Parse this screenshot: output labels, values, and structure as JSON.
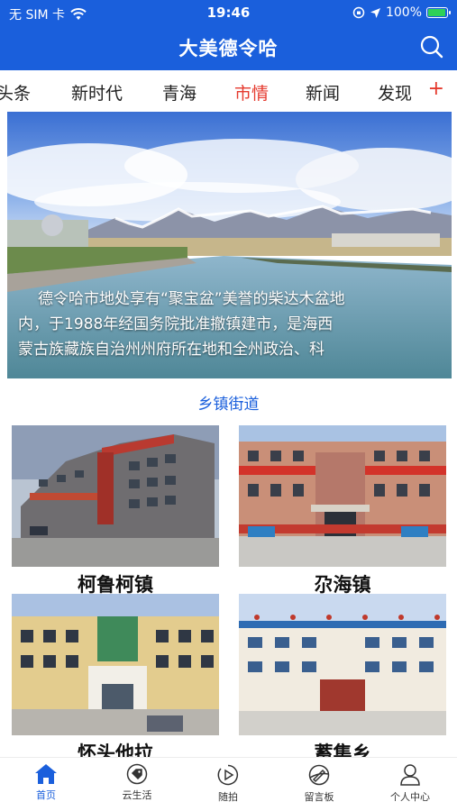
{
  "status_bar": {
    "carrier": "无 SIM 卡",
    "time": "19:46",
    "battery": "100%",
    "battery_level": 1.0
  },
  "header": {
    "title": "大美德令哈",
    "search_icon": "search-icon"
  },
  "tabs": [
    {
      "label": "头条",
      "active": false
    },
    {
      "label": "新时代",
      "active": false
    },
    {
      "label": "青海",
      "active": false
    },
    {
      "label": "市情",
      "active": true
    },
    {
      "label": "新闻",
      "active": false
    },
    {
      "label": "发现",
      "active": false
    }
  ],
  "tabs_add": "+",
  "banner": {
    "lines": [
      "德令哈市地处享有“聚宝盆”美誉的柴达木盆地",
      "内，于1988年经国务院批准撤镇建市，是海西",
      "蒙古族藏族自治州州府所在地和全州政治、科"
    ]
  },
  "section": {
    "title": "乡镇街道"
  },
  "towns": [
    {
      "name": "柯鲁柯镇"
    },
    {
      "name": "尕海镇"
    },
    {
      "name": "怀头他拉"
    },
    {
      "name": "蓄集乡"
    }
  ],
  "tabbar": [
    {
      "label": "首页",
      "icon": "home-icon",
      "active": true
    },
    {
      "label": "云生活",
      "icon": "tag-icon",
      "active": false
    },
    {
      "label": "随拍",
      "icon": "camera-play-icon",
      "active": false
    },
    {
      "label": "留言板",
      "icon": "message-board-icon",
      "active": false
    },
    {
      "label": "个人中心",
      "icon": "person-icon",
      "active": false
    }
  ],
  "colors": {
    "brand_blue": "#1a5fdc",
    "active_tab_red": "#e53a2e"
  }
}
